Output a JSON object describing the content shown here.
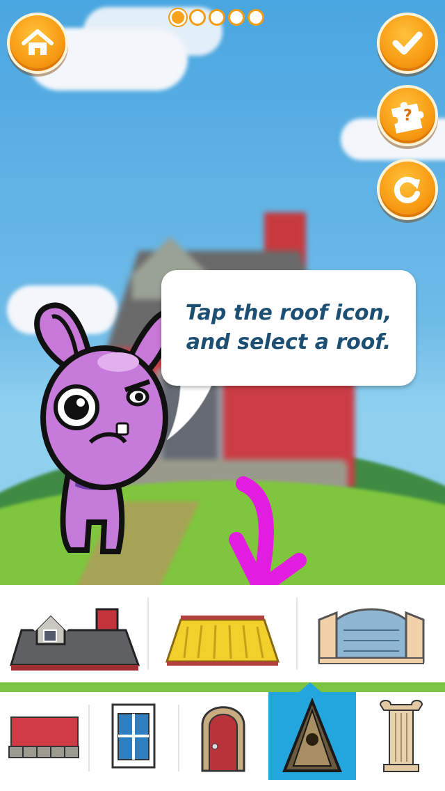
{
  "progress": {
    "total": 5,
    "current": 1
  },
  "buttons": {
    "home": "home-icon",
    "confirm": "checkmark-icon",
    "puzzle_hint": "?",
    "reset": "refresh-icon"
  },
  "bubble": {
    "text": "Tap the roof icon,\nand select a roof."
  },
  "roof_options": [
    {
      "name": "slate-roof-option"
    },
    {
      "name": "thatched-roof-option"
    },
    {
      "name": "tile-roof-option"
    }
  ],
  "categories": [
    {
      "name": "walls-category",
      "selected": false
    },
    {
      "name": "window-category",
      "selected": false
    },
    {
      "name": "door-category",
      "selected": false
    },
    {
      "name": "roof-category",
      "selected": true
    },
    {
      "name": "column-category",
      "selected": false
    }
  ],
  "colors": {
    "accent_orange": "#f79a12",
    "selected_blue": "#23a6de",
    "text_navy": "#1d4f73",
    "arrow_magenta": "#e31de0"
  }
}
